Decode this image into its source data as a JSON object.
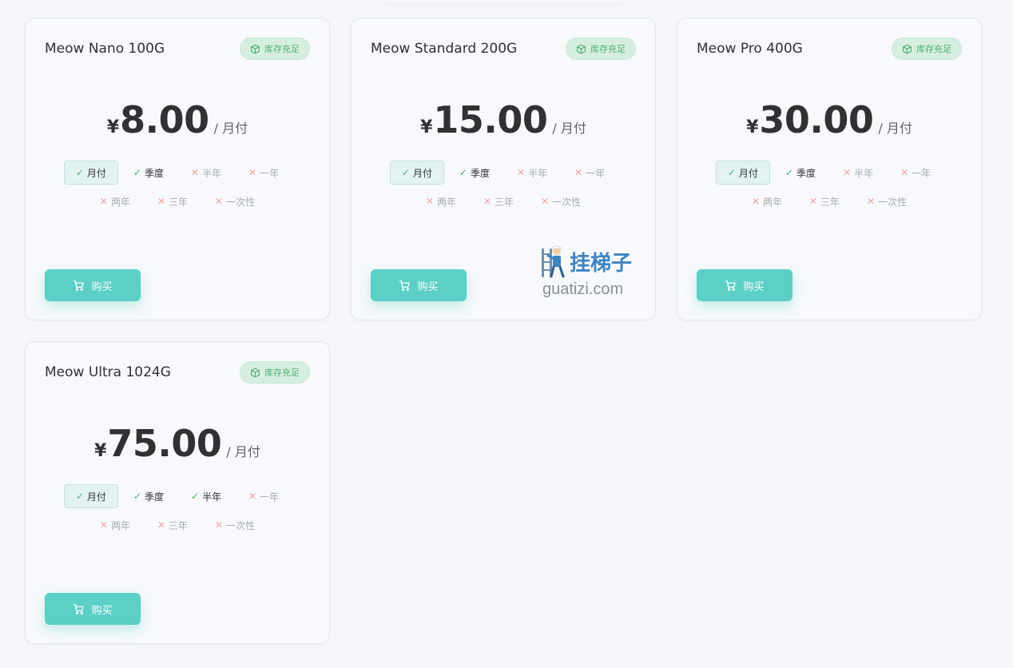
{
  "colors": {
    "accent": "#5ccfc6",
    "stock_green": "#4caf6e",
    "unavailable_red": "#f2a3a3",
    "card_bg": "#f7f9fc",
    "page_bg": "#f5f7fa"
  },
  "icons": {
    "stock": "box-icon",
    "buy": "cart-icon",
    "available": "check-icon",
    "unavailable": "x-icon"
  },
  "plans": [
    {
      "title": "Meow Nano 100G",
      "stock_label": "库存充足",
      "currency": "¥",
      "price": "8.00",
      "period": "/ 月付",
      "cycles": [
        {
          "label": "月付",
          "state": "active"
        },
        {
          "label": "季度",
          "state": "ok"
        },
        {
          "label": "半年",
          "state": "no"
        },
        {
          "label": "一年",
          "state": "no"
        },
        {
          "label": "两年",
          "state": "no"
        },
        {
          "label": "三年",
          "state": "no"
        },
        {
          "label": "一次性",
          "state": "no"
        }
      ],
      "buy_label": "购买"
    },
    {
      "title": "Meow Standard 200G",
      "stock_label": "库存充足",
      "currency": "¥",
      "price": "15.00",
      "period": "/ 月付",
      "cycles": [
        {
          "label": "月付",
          "state": "active"
        },
        {
          "label": "季度",
          "state": "ok"
        },
        {
          "label": "半年",
          "state": "no"
        },
        {
          "label": "一年",
          "state": "no"
        },
        {
          "label": "两年",
          "state": "no"
        },
        {
          "label": "三年",
          "state": "no"
        },
        {
          "label": "一次性",
          "state": "no"
        }
      ],
      "buy_label": "购买"
    },
    {
      "title": "Meow Pro 400G",
      "stock_label": "库存充足",
      "currency": "¥",
      "price": "30.00",
      "period": "/ 月付",
      "cycles": [
        {
          "label": "月付",
          "state": "active"
        },
        {
          "label": "季度",
          "state": "ok"
        },
        {
          "label": "半年",
          "state": "no"
        },
        {
          "label": "一年",
          "state": "no"
        },
        {
          "label": "两年",
          "state": "no"
        },
        {
          "label": "三年",
          "state": "no"
        },
        {
          "label": "一次性",
          "state": "no"
        }
      ],
      "buy_label": "购买"
    },
    {
      "title": "Meow Ultra 1024G",
      "stock_label": "库存充足",
      "currency": "¥",
      "price": "75.00",
      "period": "/ 月付",
      "cycles": [
        {
          "label": "月付",
          "state": "active"
        },
        {
          "label": "季度",
          "state": "ok"
        },
        {
          "label": "半年",
          "state": "ok"
        },
        {
          "label": "一年",
          "state": "no"
        },
        {
          "label": "两年",
          "state": "no"
        },
        {
          "label": "三年",
          "state": "no"
        },
        {
          "label": "一次性",
          "state": "no"
        }
      ],
      "buy_label": "购买"
    }
  ],
  "watermark": {
    "cn_text": "挂梯子",
    "en_text": "guatizi.com"
  }
}
